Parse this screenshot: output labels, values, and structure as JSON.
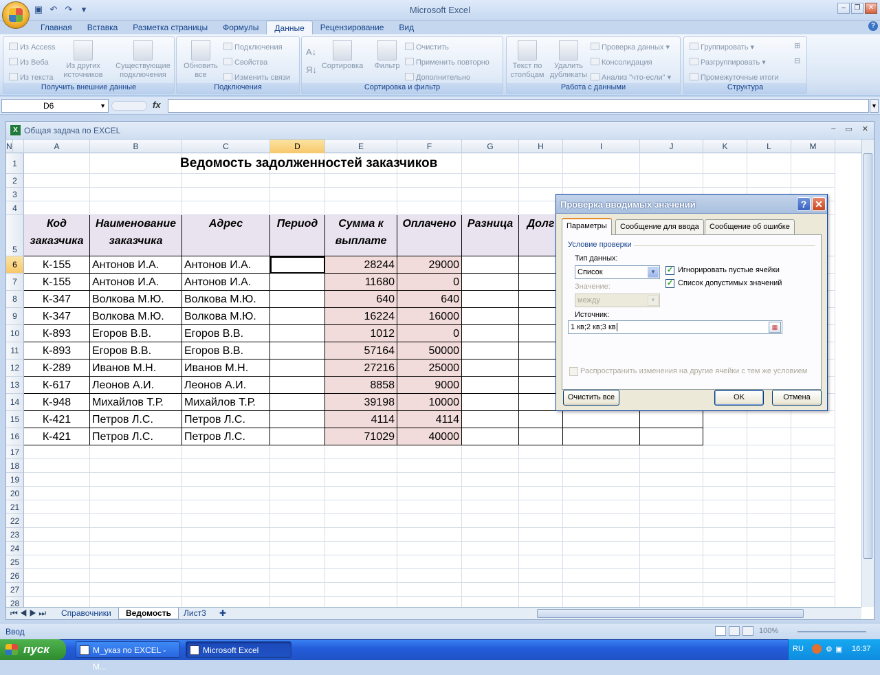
{
  "app": {
    "title": "Microsoft Excel"
  },
  "qat": {
    "icons": [
      "save-icon",
      "undo-icon",
      "redo-icon",
      "customize-icon"
    ]
  },
  "tabs": [
    "Главная",
    "Вставка",
    "Разметка страницы",
    "Формулы",
    "Данные",
    "Рецензирование",
    "Вид"
  ],
  "active_tab": "Данные",
  "ribbon": {
    "groups": {
      "external": "Получить внешние данные",
      "connections": "Подключения",
      "sortfilter": "Сортировка и фильтр",
      "datatools": "Работа с данными",
      "outline": "Структура"
    },
    "from_access": "Из Access",
    "from_web": "Из Веба",
    "from_text": "Из текста",
    "other_sources": "Из других источников",
    "existing": "Существующие подключения",
    "refresh_all": "Обновить все",
    "connections": "Подключения",
    "properties": "Свойства",
    "edit_links": "Изменить связи",
    "sort": "Сортировка",
    "filter": "Фильтр",
    "clear": "Очистить",
    "reapply": "Применить повторно",
    "advanced": "Дополнительно",
    "text_to_columns": "Текст по столбцам",
    "remove_duplicates": "Удалить дубликаты",
    "data_validation": "Проверка данных",
    "consolidate": "Консолидация",
    "whatif": "Анализ \"что-если\"",
    "group": "Группировать",
    "ungroup": "Разгруппировать",
    "subtotal": "Промежуточные итоги"
  },
  "formula_bar": {
    "name_box": "D6",
    "fx": "fx",
    "value": ""
  },
  "workbook": {
    "title": "Общая задача по EXCEL"
  },
  "columns": [
    "A",
    "B",
    "C",
    "D",
    "E",
    "F",
    "G",
    "H",
    "I",
    "J",
    "K",
    "L",
    "M",
    "N"
  ],
  "selected_col": "D",
  "rows": [
    "1",
    "2",
    "3",
    "4",
    "5",
    "6",
    "7",
    "8",
    "9",
    "10",
    "11",
    "12",
    "13",
    "14",
    "15",
    "16",
    "17",
    "18",
    "19",
    "20",
    "21",
    "22",
    "23",
    "24",
    "25",
    "26",
    "27",
    "28"
  ],
  "selected_row": "6",
  "sheet_title": "Ведомость задолженностей заказчиков",
  "table_headers": [
    "Код заказчика",
    "Наименование заказчика",
    "Адрес",
    "Период",
    "Сумма к выплате",
    "Оплачено",
    "Разница",
    "Долг"
  ],
  "table_rows": [
    [
      "К-155",
      "Антонов И.А.",
      "Антонов И.А.",
      "",
      "28244",
      "29000"
    ],
    [
      "К-155",
      "Антонов И.А.",
      "Антонов И.А.",
      "",
      "11680",
      "0"
    ],
    [
      "К-347",
      "Волкова М.Ю.",
      "Волкова М.Ю.",
      "",
      "640",
      "640"
    ],
    [
      "К-347",
      "Волкова М.Ю.",
      "Волкова М.Ю.",
      "",
      "16224",
      "16000"
    ],
    [
      "К-893",
      "Егоров В.В.",
      "Егоров В.В.",
      "",
      "1012",
      "0"
    ],
    [
      "К-893",
      "Егоров В.В.",
      "Егоров В.В.",
      "",
      "57164",
      "50000"
    ],
    [
      "К-289",
      "Иванов М.Н.",
      "Иванов М.Н.",
      "",
      "27216",
      "25000"
    ],
    [
      "К-617",
      "Леонов А.И.",
      "Леонов А.И.",
      "",
      "8858",
      "9000"
    ],
    [
      "К-948",
      "Михайлов Т.Р.",
      "Михайлов Т.Р.",
      "",
      "39198",
      "10000"
    ],
    [
      "К-421",
      "Петров Л.С.",
      "Петров Л.С.",
      "",
      "4114",
      "4114"
    ],
    [
      "К-421",
      "Петров Л.С.",
      "Петров Л.С.",
      "",
      "71029",
      "40000"
    ]
  ],
  "sheets": [
    "Справочники",
    "Ведомость",
    "Лист3"
  ],
  "active_sheet": "Ведомость",
  "status": {
    "mode": "Ввод",
    "zoom": "100%"
  },
  "dialog": {
    "title": "Проверка вводимых значений",
    "tabs": [
      "Параметры",
      "Сообщение для ввода",
      "Сообщение об ошибке"
    ],
    "section": "Условие проверки",
    "type_label": "Тип данных:",
    "type_value": "Список",
    "value_label": "Значение:",
    "value_value": "между",
    "ignore_blank": "Игнорировать пустые ячейки",
    "in_cell_dropdown": "Список допустимых значений",
    "source_label": "Источник:",
    "source_value": "1 кв;2 кв;3 кв",
    "apply_all": "Распространить изменения на другие ячейки с тем же условием",
    "clear_all": "Очистить все",
    "ok": "OK",
    "cancel": "Отмена"
  },
  "taskbar": {
    "start": "пуск",
    "tasks": [
      "М_указ по EXCEL - M...",
      "Microsoft Excel"
    ],
    "lang": "RU",
    "time": "16:37"
  }
}
